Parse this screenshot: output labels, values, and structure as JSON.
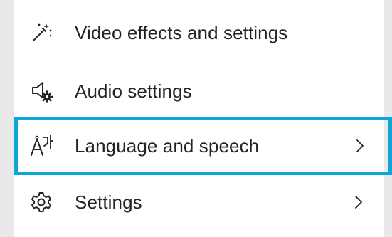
{
  "menu": {
    "items": [
      {
        "label": "Video effects and settings",
        "icon": "video-effects-wand-icon",
        "has_submenu": false
      },
      {
        "label": "Audio settings",
        "icon": "speaker-gear-icon",
        "has_submenu": false
      },
      {
        "label": "Language and speech",
        "icon": "language-translate-icon",
        "has_submenu": true,
        "focused": true
      },
      {
        "label": "Settings",
        "icon": "gear-icon",
        "has_submenu": true
      }
    ]
  },
  "colors": {
    "focus_ring": "#0ba7d6",
    "text": "#252423",
    "background": "#ffffff",
    "backdrop": "#e9e9e9"
  }
}
